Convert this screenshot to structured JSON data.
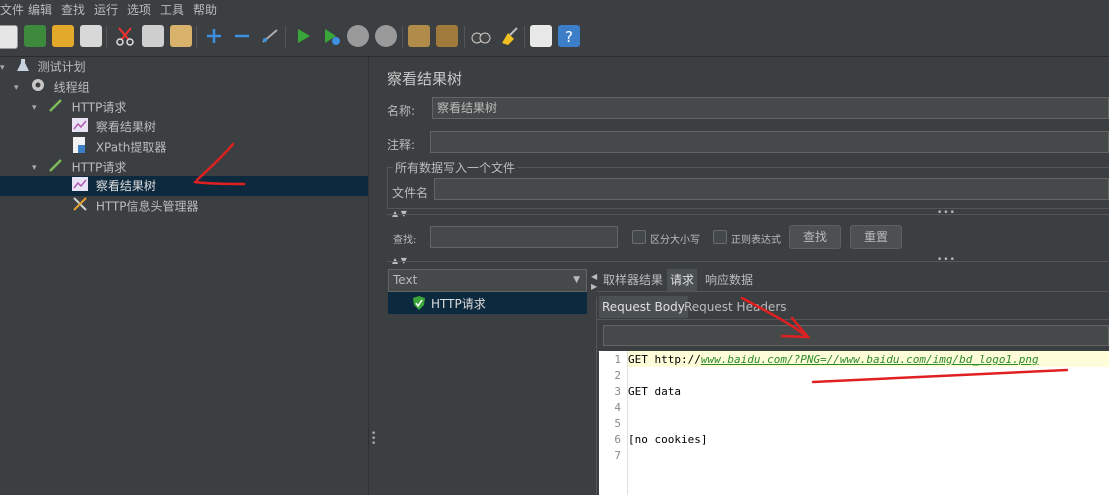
{
  "menu": [
    "文件",
    "编辑",
    "查找",
    "运行",
    "选项",
    "工具",
    "帮助"
  ],
  "tree": {
    "plan": "测试计划",
    "thread_group": "线程组",
    "http1": "HTTP请求",
    "view1": "察看结果树",
    "xpath": "XPath提取器",
    "http2": "HTTP请求",
    "view2": "察看结果树",
    "header_mgr": "HTTP信息头管理器"
  },
  "panel": {
    "title": "察看结果树",
    "name_label": "名称:",
    "name_value": "察看结果树",
    "comment_label": "注释:",
    "file_group": "所有数据写入一个文件",
    "filename_label": "文件名",
    "search_label": "查找:",
    "case_label": "区分大小写",
    "regex_label": "正则表达式",
    "search_btn": "查找",
    "reset_btn": "重置"
  },
  "results": {
    "renderer": "Text",
    "sample": "HTTP请求"
  },
  "tabs": {
    "sampler": "取样器结果",
    "request": "请求",
    "response": "响应数据",
    "req_body": "Request Body",
    "req_headers": "Request Headers"
  },
  "editor": {
    "line_numbers": [
      "1",
      "2",
      "3",
      "4",
      "5",
      "6",
      "7"
    ],
    "l1_prefix": "GET http://",
    "l1_link": "www.baidu.com/?PNG=//www.baidu.com/img/bd_logo1.png",
    "l3": "GET data",
    "l6": "[no cookies]"
  },
  "colors": {
    "background": "#3c3f41",
    "selection": "#0d293e",
    "annotation_red": "#e02020",
    "highlight_line": "#fefcd9"
  }
}
